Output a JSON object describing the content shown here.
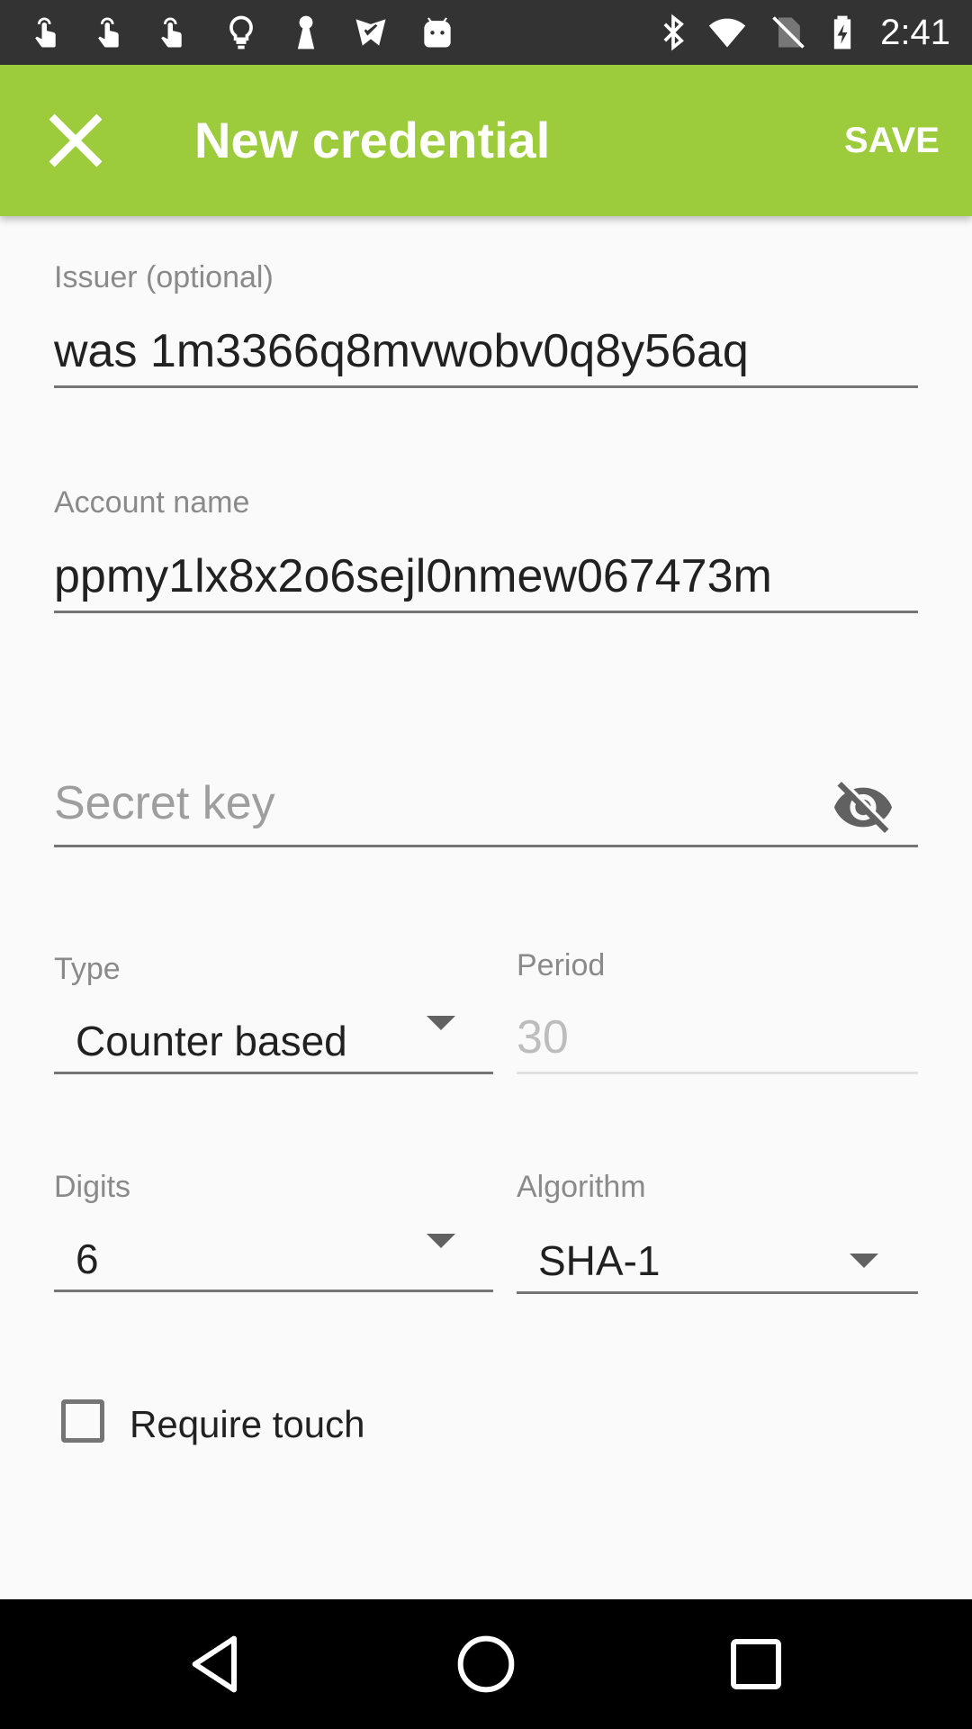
{
  "status_bar": {
    "time": "2:41",
    "left_icons": [
      "touch-app-icon",
      "touch-app-icon",
      "touch-app-icon",
      "lightbulb-icon",
      "keyhole-icon",
      "check-icon",
      "android-icon"
    ],
    "right_icons": [
      "bluetooth-icon",
      "wifi-icon",
      "no-sim-icon",
      "battery-charging-icon"
    ]
  },
  "app_bar": {
    "title": "New credential",
    "save_label": "SAVE",
    "background_color": "#9ccb3c"
  },
  "form": {
    "issuer": {
      "label": "Issuer (optional)",
      "value": "was 1m3366q8mvwobv0q8y56aq"
    },
    "account": {
      "label": "Account name",
      "value": "ppmy1lx8x2o6sejl0nmew067473m"
    },
    "secret": {
      "placeholder": "Secret key"
    },
    "type": {
      "label": "Type",
      "value": "Counter based"
    },
    "period": {
      "label": "Period",
      "value": "30"
    },
    "digits": {
      "label": "Digits",
      "value": "6"
    },
    "algorithm": {
      "label": "Algorithm",
      "value": "SHA-1"
    },
    "require_touch": {
      "label": "Require touch",
      "checked": false
    }
  }
}
